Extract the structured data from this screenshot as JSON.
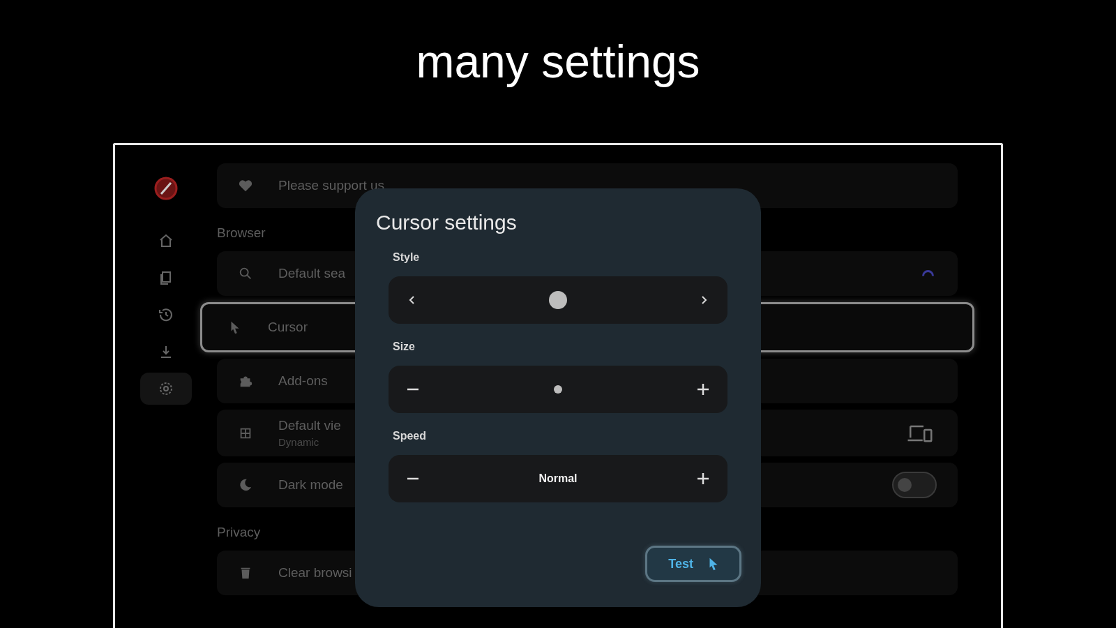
{
  "headline": "many settings",
  "sidebar": {
    "items": [
      {
        "selected": false
      },
      {
        "selected": false
      },
      {
        "selected": false
      },
      {
        "selected": false
      },
      {
        "selected": true
      }
    ]
  },
  "settings": {
    "items": [
      {
        "kind": "row",
        "label": "Please support us",
        "focused": false
      },
      {
        "kind": "section",
        "label": "Browser"
      },
      {
        "kind": "row",
        "label": "Default sea",
        "focused": false
      },
      {
        "kind": "row",
        "label": "Cursor",
        "focused": true
      },
      {
        "kind": "row",
        "label": "Add-ons",
        "focused": false
      },
      {
        "kind": "row",
        "label": "Default vie",
        "subtitle": "Dynamic",
        "focused": false
      },
      {
        "kind": "toggle",
        "label": "Dark mode",
        "focused": false,
        "on": false
      },
      {
        "kind": "section",
        "label": "Privacy"
      },
      {
        "kind": "row",
        "label": "Clear browsi",
        "focused": false
      }
    ]
  },
  "dialog": {
    "title": "Cursor settings",
    "controls": [
      {
        "kind": "arrows",
        "label": "Style"
      },
      {
        "kind": "stepper",
        "label": "Size"
      },
      {
        "kind": "stepper",
        "label": "Speed",
        "value": "Normal"
      }
    ],
    "button": "Test"
  }
}
